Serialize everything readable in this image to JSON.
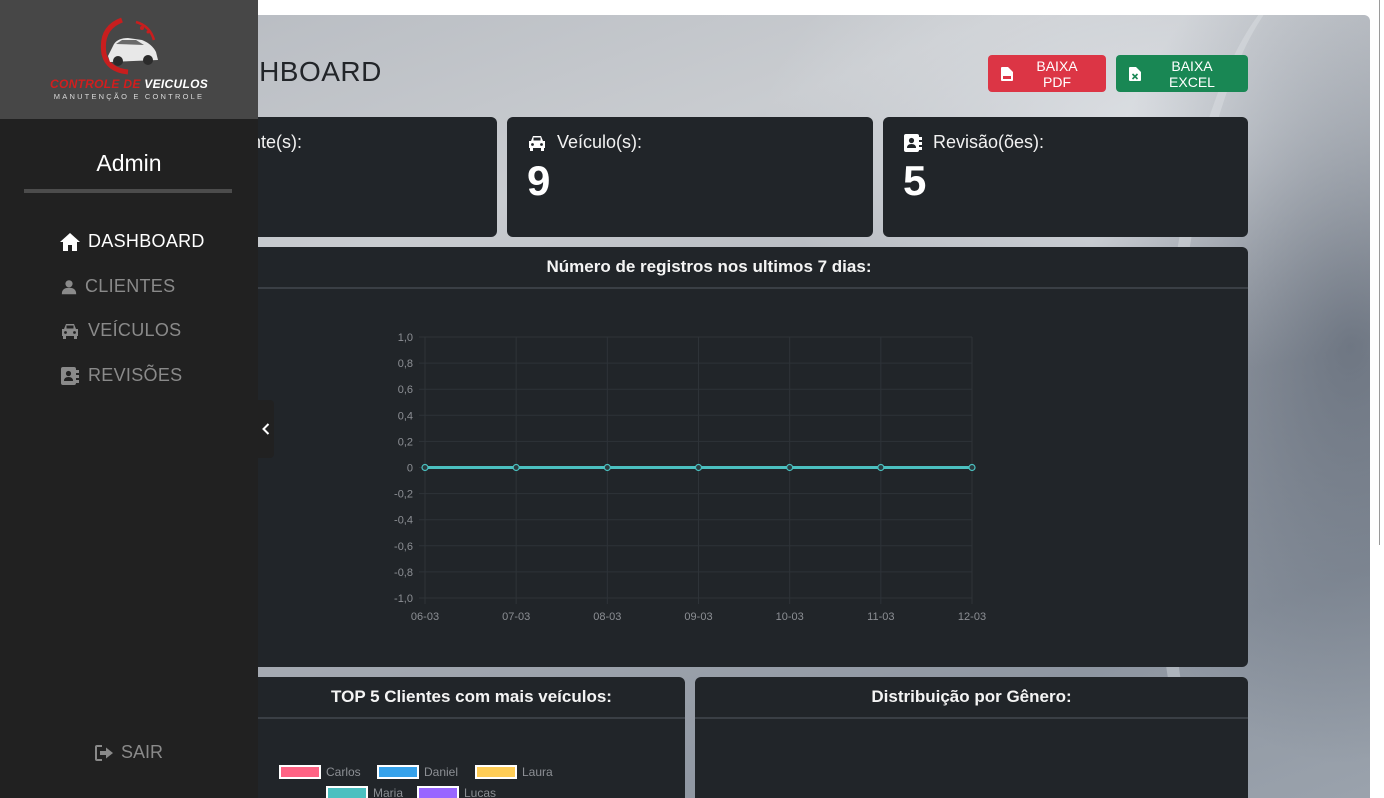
{
  "header": {
    "title": "DASHBOARD",
    "pdf_button": "BAIXA PDF",
    "excel_button": "BAIXA EXCEL"
  },
  "stats": [
    {
      "label": "Cliente(s):",
      "value": "",
      "icon": "user-icon"
    },
    {
      "label": "Veículo(s):",
      "value": "9",
      "icon": "car-icon"
    },
    {
      "label": "Revisão(ões):",
      "value": "5",
      "icon": "address-book-icon"
    }
  ],
  "sidebar": {
    "logo_line1_red": "CONTROLE DE",
    "logo_line1_white": "VEICULOS",
    "logo_line2": "MANUTENÇÃO E CONTROLE",
    "user": "Admin",
    "items": [
      {
        "label": "DASHBOARD",
        "icon": "home-icon",
        "active": true
      },
      {
        "label": "CLIENTES",
        "icon": "user-icon",
        "active": false
      },
      {
        "label": "VEÍCULOS",
        "icon": "car-icon",
        "active": false
      },
      {
        "label": "REVISÕES",
        "icon": "address-book-icon",
        "active": false
      }
    ],
    "logout": "SAIR"
  },
  "colors": {
    "card_bg": "#212529",
    "sidebar_bg": "#212121",
    "pdf": "#dc3545",
    "excel": "#198754",
    "line": "#4bc0c0"
  },
  "chart_data": [
    {
      "type": "line",
      "title": "Número de registros nos ultimos 7 dias:",
      "x": [
        "06-03",
        "07-03",
        "08-03",
        "09-03",
        "10-03",
        "11-03",
        "12-03"
      ],
      "series": [
        {
          "values": [
            0,
            0,
            0,
            0,
            0,
            0,
            0
          ]
        }
      ],
      "ylim": [
        -1.0,
        1.0
      ],
      "yticks": [
        "1,0",
        "0,8",
        "0,6",
        "0,4",
        "0,2",
        "0",
        "-0,2",
        "-0,4",
        "-0,6",
        "-0,8",
        "-1,0"
      ],
      "grid": true
    },
    {
      "type": "bar",
      "title": "TOP 5 Clientes com mais veículos:",
      "legend": [
        {
          "name": "Carlos",
          "color": "#ff6384"
        },
        {
          "name": "Daniel",
          "color": "#36a2eb"
        },
        {
          "name": "Laura",
          "color": "#ffcd56"
        },
        {
          "name": "Maria",
          "color": "#4bc0c0"
        },
        {
          "name": "Lucas",
          "color": "#9966ff"
        }
      ]
    },
    {
      "type": "pie",
      "title": "Distribuição por Gênero:"
    }
  ]
}
